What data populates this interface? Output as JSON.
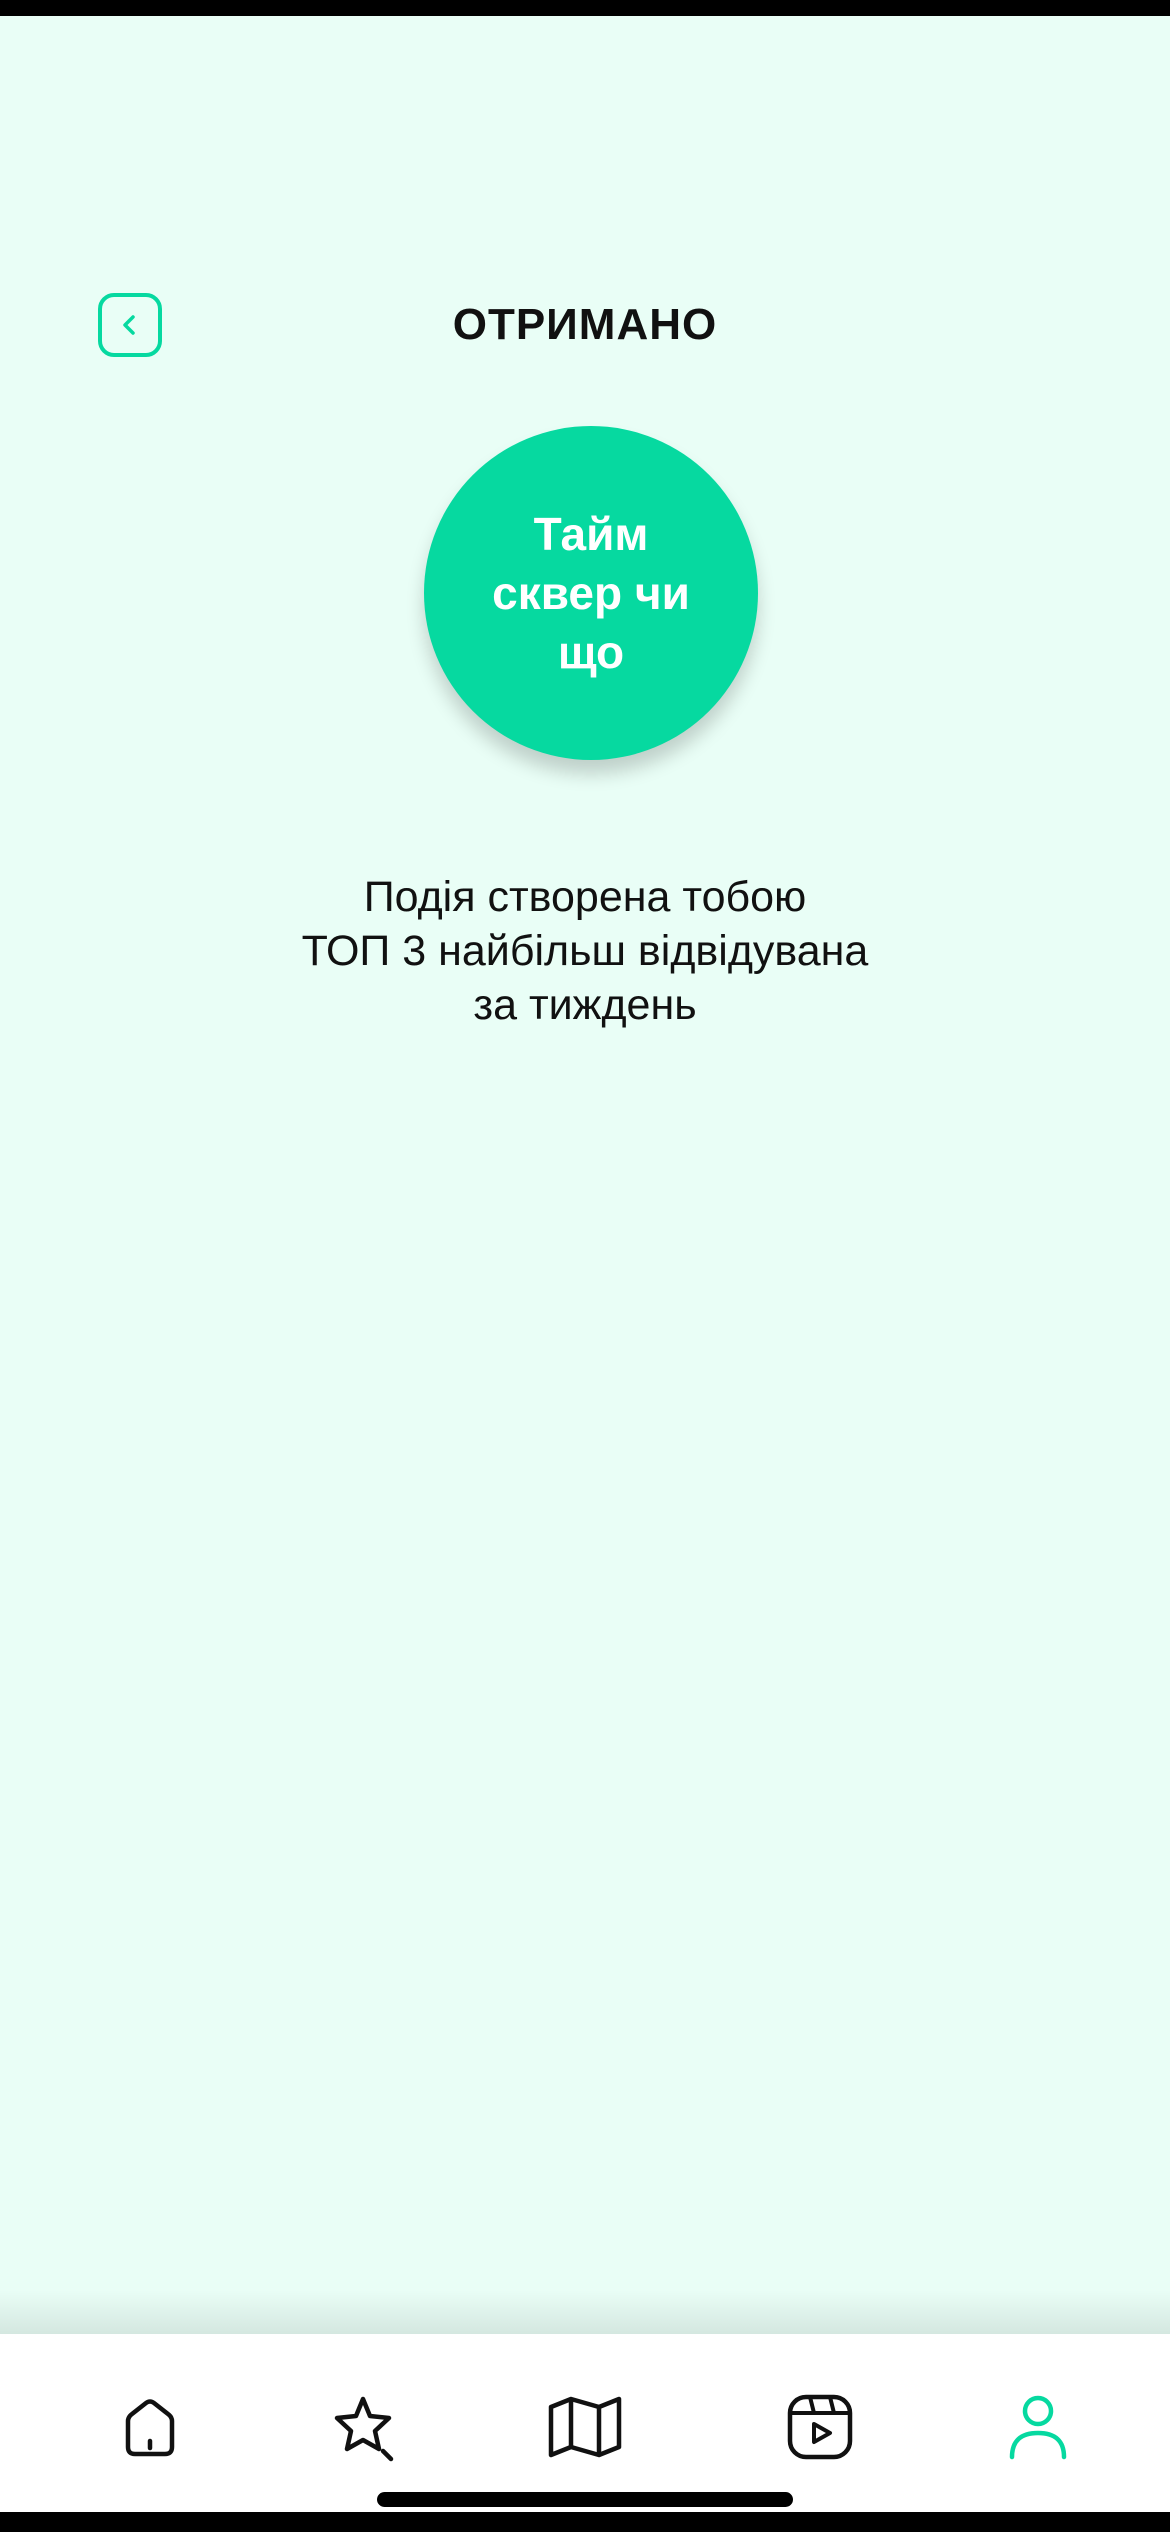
{
  "header": {
    "title": "ОТРИМАНО",
    "back_icon": "chevron-left-icon"
  },
  "badge": {
    "title": "Тайм сквер чи що"
  },
  "description": {
    "lines": [
      "Подія створена тобою",
      "ТОП 3 найбільш відвідувана",
      "за тиждень"
    ]
  },
  "tab_bar": {
    "tabs": [
      {
        "icon": "home-icon",
        "active": false
      },
      {
        "icon": "star-icon",
        "active": false
      },
      {
        "icon": "map-icon",
        "active": false
      },
      {
        "icon": "video-icon",
        "active": false
      },
      {
        "icon": "profile-icon",
        "active": true
      }
    ]
  },
  "colors": {
    "accent": "#06D9A0",
    "background": "#E9FEF6",
    "tab_bar_background": "#FFFFFF",
    "text": "#111111"
  }
}
